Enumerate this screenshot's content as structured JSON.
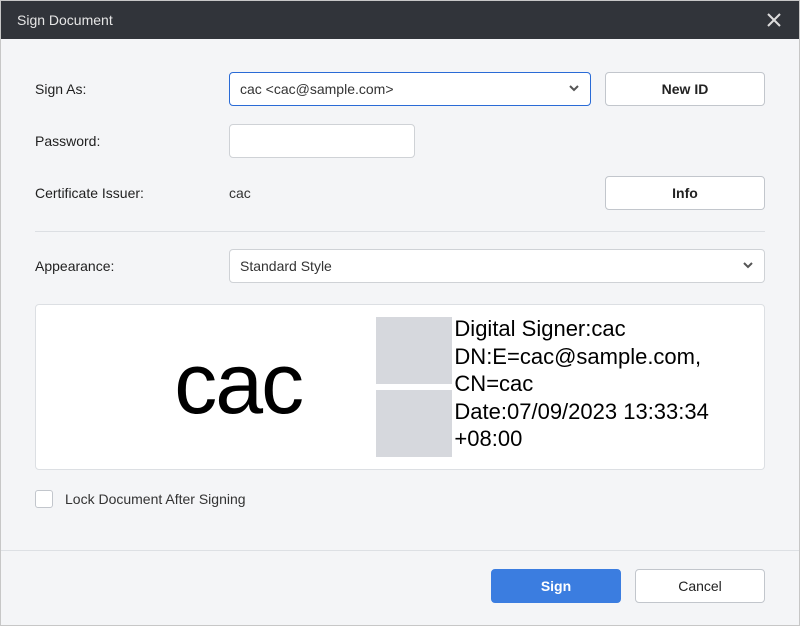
{
  "title": "Sign Document",
  "labels": {
    "signAs": "Sign As:",
    "password": "Password:",
    "issuer": "Certificate Issuer:",
    "appearance": "Appearance:",
    "lock": "Lock Document After Signing"
  },
  "signAs": {
    "value": "cac <cac@sample.com>"
  },
  "issuerValue": "cac",
  "appearanceValue": "Standard Style",
  "buttons": {
    "newId": "New ID",
    "info": "Info",
    "sign": "Sign",
    "cancel": "Cancel"
  },
  "preview": {
    "bigName": "cac",
    "line1": "Digital Signer:cac",
    "line2": "DN:E=cac@sample.com,",
    "line3": "CN=cac",
    "line4": "Date:07/09/2023 13:33:34",
    "line5": "+08:00"
  }
}
